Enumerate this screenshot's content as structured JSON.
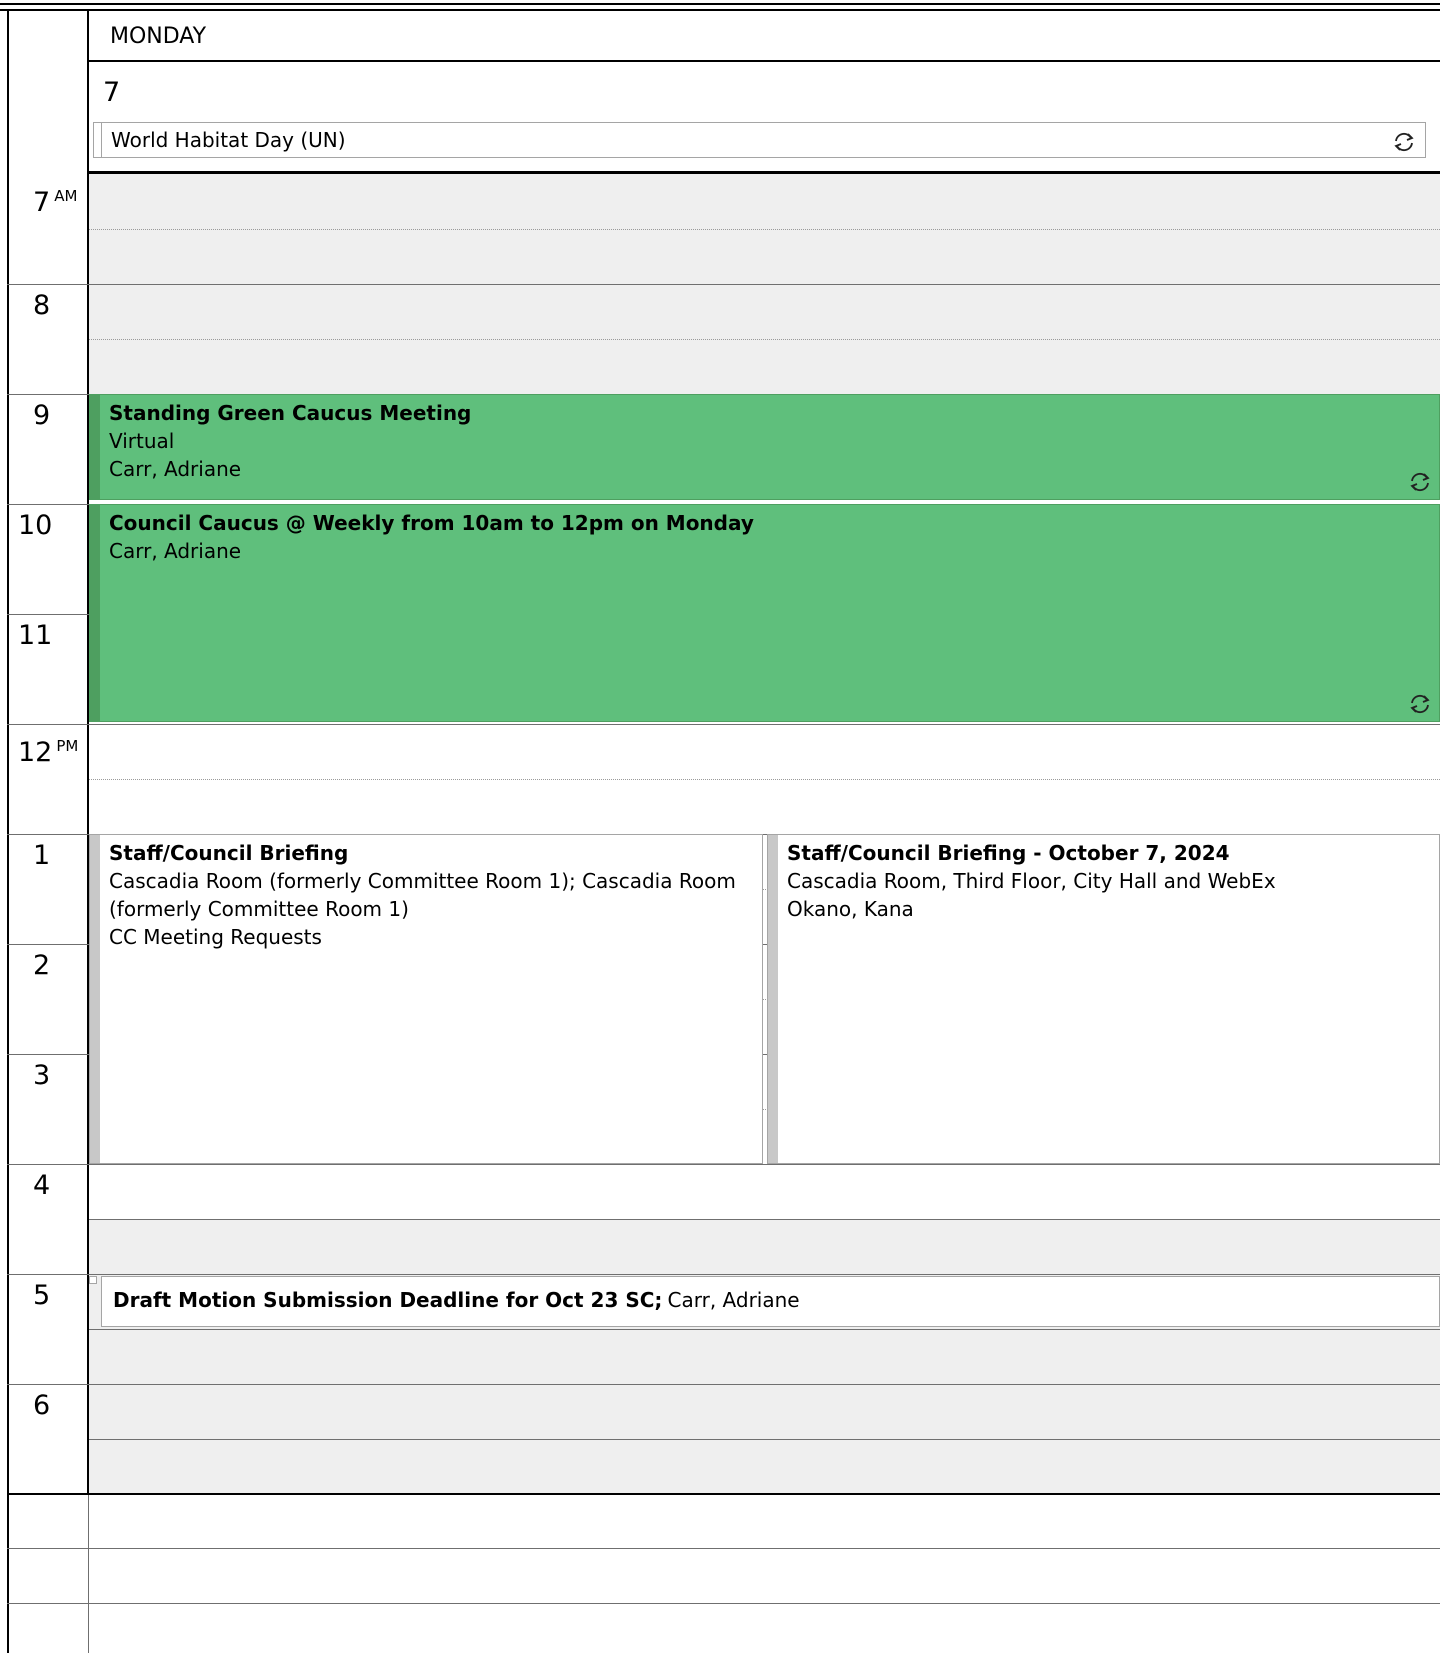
{
  "day": {
    "weekday": "MONDAY",
    "date_number": "7"
  },
  "all_day_event": {
    "title": "World Habitat Day (UN)",
    "icon": "recurring-icon"
  },
  "time_labels": [
    {
      "hour": "7",
      "suffix": "AM"
    },
    {
      "hour": "8",
      "suffix": ""
    },
    {
      "hour": "9",
      "suffix": ""
    },
    {
      "hour": "10",
      "suffix": ""
    },
    {
      "hour": "11",
      "suffix": ""
    },
    {
      "hour": "12",
      "suffix": "PM"
    },
    {
      "hour": "1",
      "suffix": ""
    },
    {
      "hour": "2",
      "suffix": ""
    },
    {
      "hour": "3",
      "suffix": ""
    },
    {
      "hour": "4",
      "suffix": ""
    },
    {
      "hour": "5",
      "suffix": ""
    },
    {
      "hour": "6",
      "suffix": ""
    }
  ],
  "events": {
    "green_caucus": {
      "title": "Standing Green Caucus Meeting",
      "location": "Virtual",
      "organizer": "Carr, Adriane",
      "color": "#5fbf7c",
      "recurring": true
    },
    "council_caucus": {
      "title": "Council Caucus @ Weekly from 10am to 12pm on Monday",
      "organizer": "Carr, Adriane",
      "color": "#5fbf7c",
      "recurring": true
    },
    "briefing_left": {
      "title": "Staff/Council Briefing",
      "location_line1": "Cascadia Room (formerly Committee Room 1); Cascadia Room",
      "location_line2": "(formerly Committee Room 1)",
      "calendar": "CC Meeting Requests"
    },
    "briefing_right": {
      "title": "Staff/Council Briefing - October 7, 2024",
      "location": "Cascadia Room, Third Floor, City Hall and WebEx",
      "organizer": "Okano, Kana"
    },
    "draft_motion": {
      "title": "Draft Motion Submission Deadline for Oct 23 SC;",
      "organizer": "Carr, Adriane"
    }
  },
  "colors": {
    "event_green": "#5fbf7c",
    "event_green_edge": "#4e9f60",
    "outside_hours": "#efefef",
    "tentative_bar": "#c8c8c8"
  }
}
